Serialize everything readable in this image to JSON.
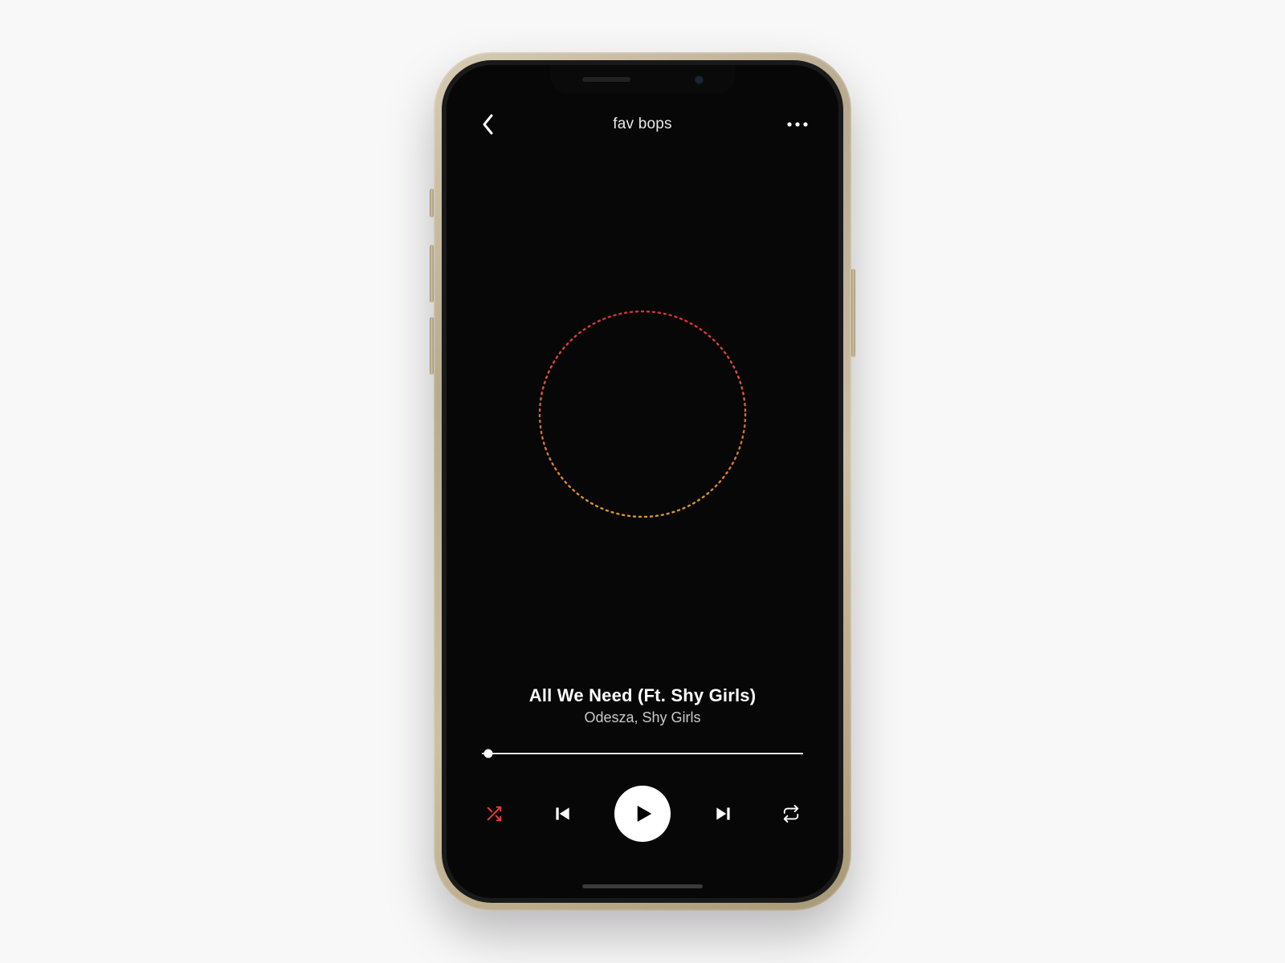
{
  "header": {
    "playlist_title": "fav bops"
  },
  "track": {
    "title": "All We Need (Ft. Shy Girls)",
    "artist": "Odesza, Shy Girls"
  },
  "progress": {
    "percent": 2
  },
  "colors": {
    "accent_shuffle": "#e63a3a",
    "viz_top": "#da2f3e",
    "viz_bottom": "#d79a2f"
  },
  "icons": {
    "back": "chevron-left-icon",
    "more": "more-horizontal-icon",
    "shuffle": "shuffle-icon",
    "previous": "skip-previous-icon",
    "play": "play-icon",
    "next": "skip-next-icon",
    "repeat": "repeat-icon"
  }
}
